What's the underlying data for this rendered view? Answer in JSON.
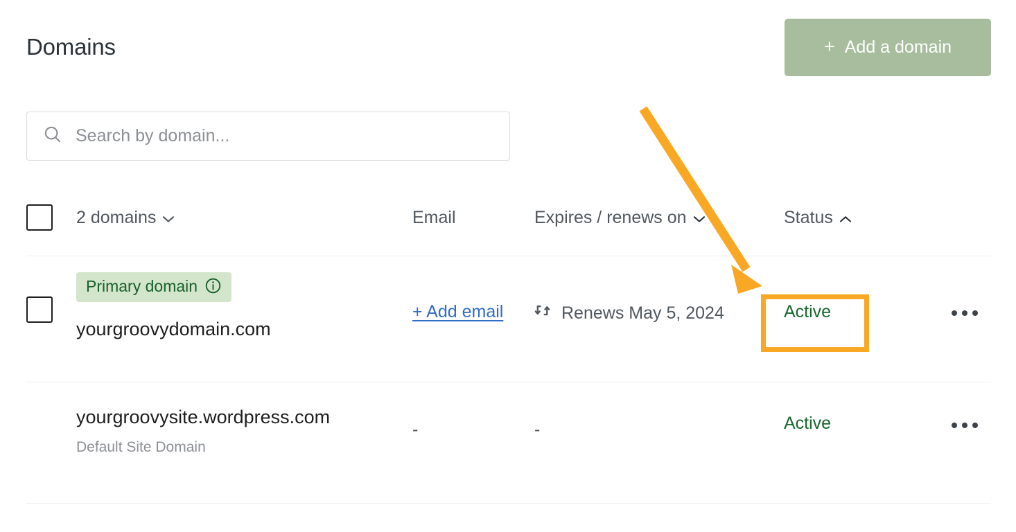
{
  "header": {
    "title": "Domains",
    "add_domain_label": "Add a domain",
    "add_domain_plus": "+",
    "add_domain_icon": "plus-icon",
    "add_domain_color": "#a7bd9d"
  },
  "search": {
    "icon": "search-icon",
    "value": "",
    "placeholder": "Search by domain..."
  },
  "table": {
    "columns": {
      "select_all": "",
      "count_label": "2 domains",
      "count_chevron": "chevron-down-icon",
      "email": "Email",
      "expiry": "Expires / renews on",
      "expiry_chevron": "chevron-down-icon",
      "status": "Status",
      "status_chevron": "chevron-up-icon"
    },
    "rows": [
      {
        "badge": "Primary domain",
        "badge_icon": "info-circle-icon",
        "badge_bg": "#d3e5cb",
        "badge_color": "#17602a",
        "name": "yourgroovydomain.com",
        "subtitle": "",
        "email": "+ Add email",
        "email_is_link": true,
        "expiry_icon": "sync-arrows-icon",
        "expiry": "Renews May 5, 2024",
        "status": "Active",
        "status_color": "#18682c",
        "menu_icon": "ellipsis-icon",
        "highlighted": true
      },
      {
        "badge": "",
        "name": "yourgroovysite.wordpress.com",
        "subtitle": "Default Site Domain",
        "email": "-",
        "email_is_link": false,
        "expiry_icon": "",
        "expiry": "-",
        "status": "Active",
        "status_color": "#18682c",
        "menu_icon": "ellipsis-icon",
        "highlighted": false
      }
    ]
  },
  "annotations": {
    "arrow_color": "#f9a825",
    "highlight_color": "#f9a825",
    "arrow_from": "928,157",
    "arrow_to": "1092,412",
    "target": "Active status of yourgroovydomain.com"
  }
}
